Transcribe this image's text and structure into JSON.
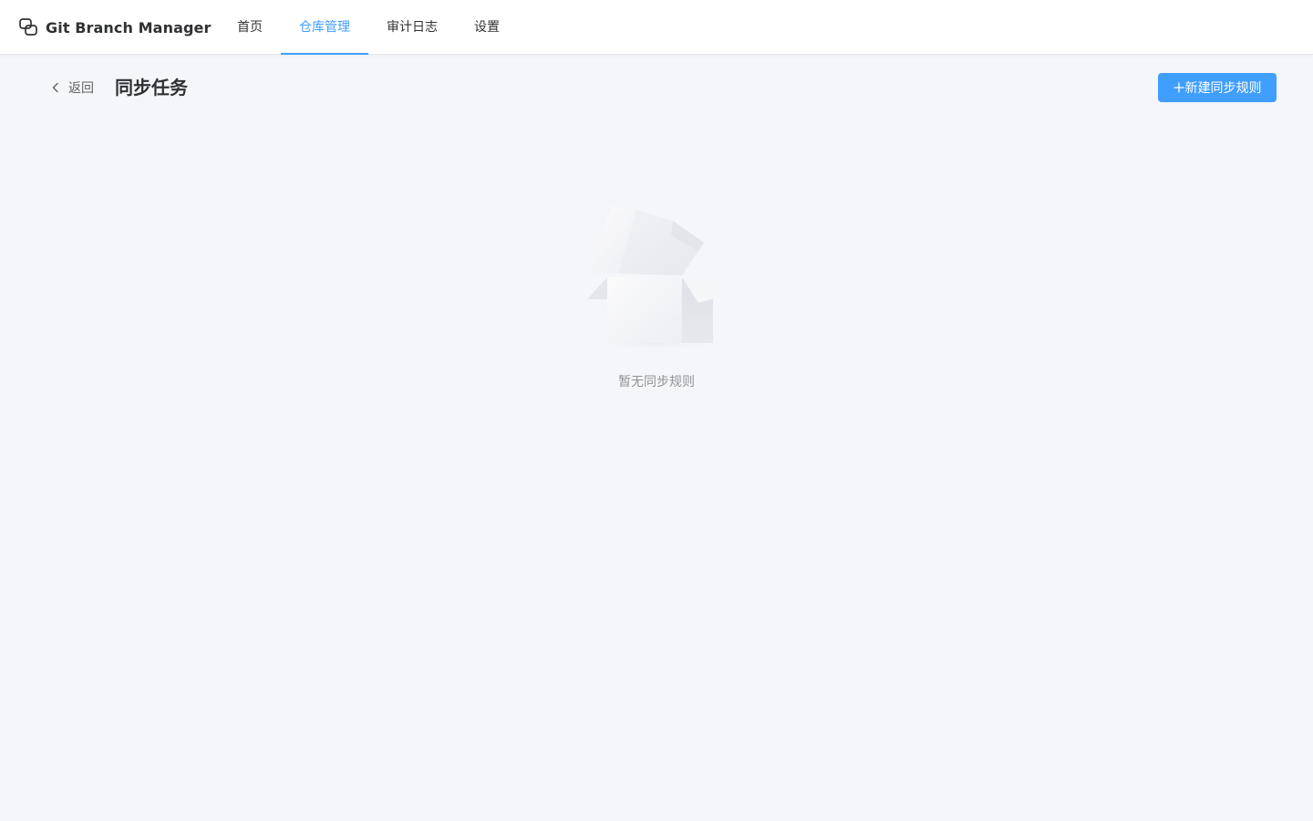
{
  "app": {
    "title": "Git Branch Manager"
  },
  "nav": {
    "items": [
      {
        "label": "首页",
        "active": false
      },
      {
        "label": "仓库管理",
        "active": true
      },
      {
        "label": "审计日志",
        "active": false
      },
      {
        "label": "设置",
        "active": false
      }
    ]
  },
  "header": {
    "back_label": "返回",
    "title": "同步任务",
    "new_button_label": "新建同步规则"
  },
  "empty_state": {
    "text": "暂无同步规则"
  },
  "colors": {
    "accent": "#409eff",
    "background": "#f4f6fa",
    "text_primary": "#303133",
    "text_muted": "#909399"
  },
  "icons": {
    "brand": "linked-squares-icon",
    "back": "chevron-left-icon",
    "add": "plus-icon",
    "empty": "empty-box-illustration"
  }
}
